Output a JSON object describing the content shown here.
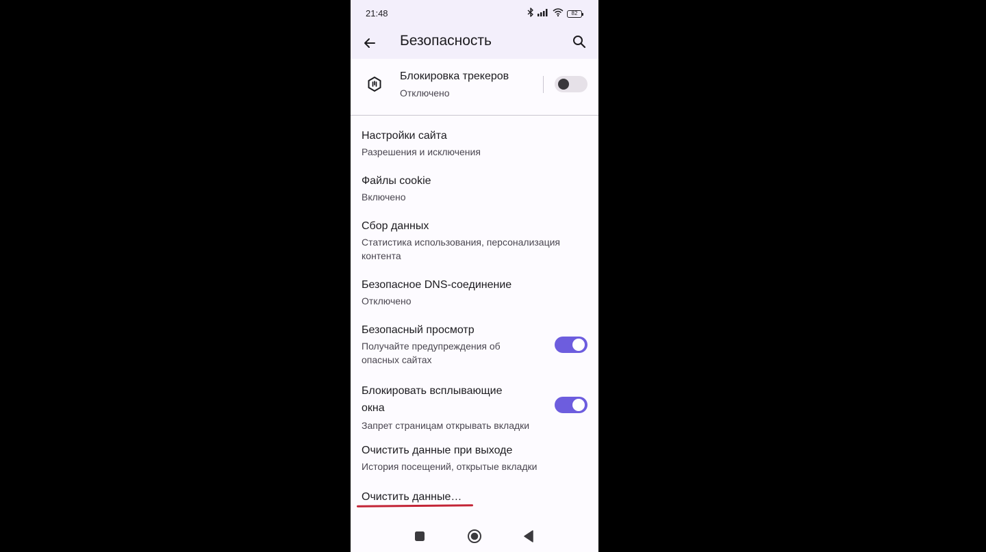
{
  "status_bar": {
    "time": "21:48",
    "battery_level": "82",
    "icons": [
      "bluetooth-icon",
      "signal-icon",
      "wifi-icon",
      "battery-icon"
    ]
  },
  "app_bar": {
    "title": "Безопасность",
    "back_icon": "arrow-left-icon",
    "search_icon": "search-icon"
  },
  "tracker_blocking": {
    "title": "Блокировка трекеров",
    "subtitle": "Отключено",
    "enabled": false,
    "icon": "shield-tracker-icon"
  },
  "settings": [
    {
      "title": "Настройки сайта",
      "subtitle": "Разрешения и исключения"
    },
    {
      "title": "Файлы cookie",
      "subtitle": "Включено"
    },
    {
      "title": "Сбор данных",
      "subtitle": "Статистика использования, персонализация контента"
    },
    {
      "title": "Безопасное DNS-соединение",
      "subtitle": "Отключено"
    },
    {
      "title": "Безопасный просмотр",
      "subtitle": "Получайте предупреждения об опасных сайтах",
      "enabled": true
    },
    {
      "title": "Блокировать всплывающие окна",
      "subtitle": "Запрет страницам открывать вкладки",
      "enabled": true
    },
    {
      "title": "Очистить данные при выходе",
      "subtitle": "История посещений, открытые вкладки"
    },
    {
      "title": "Очистить данные…"
    }
  ],
  "colors": {
    "accent": "#6d5dde",
    "app_bar_bg": "#f3effb",
    "annotation_underline": "#c32436"
  },
  "nav_bar": {
    "icons": [
      "recent-apps-icon",
      "home-icon",
      "back-triangle-icon"
    ]
  }
}
